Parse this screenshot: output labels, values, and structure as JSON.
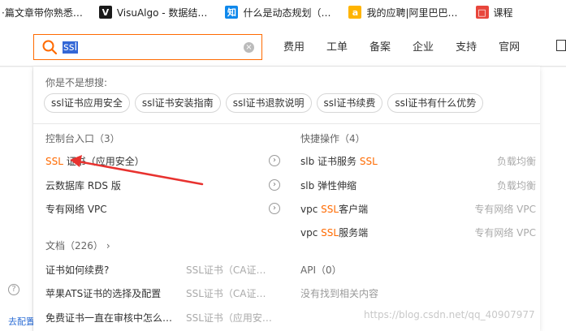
{
  "bookmarks": [
    {
      "icon": "doc-icon",
      "label": "·篇文章带你熟悉…"
    },
    {
      "icon": "visualgo-icon",
      "label": "VisuAlgo - 数据结…"
    },
    {
      "icon": "zhihu-icon",
      "label": "什么是动态规划（…"
    },
    {
      "icon": "ali-icon",
      "label": "我的应聘|阿里巴巴…"
    },
    {
      "icon": "course-icon",
      "label": "课程"
    }
  ],
  "search": {
    "value": "ssl"
  },
  "nav": [
    "费用",
    "工单",
    "备案",
    "企业",
    "支持",
    "官网"
  ],
  "suggest": {
    "title": "你是不是想搜:",
    "chips": [
      "ssl证书应用安全",
      "ssl证书安装指南",
      "ssl证书退款说明",
      "ssl证书续费",
      "ssl证书有什么优势"
    ]
  },
  "console": {
    "title": "控制台入口（3）",
    "items": [
      {
        "pre": "",
        "hl": "SSL",
        "post": " 证书",
        "suffix": "（应用安全）"
      },
      {
        "pre": "云数据库 RDS 版",
        "hl": "",
        "post": "",
        "suffix": ""
      },
      {
        "pre": "专有网络 VPC",
        "hl": "",
        "post": "",
        "suffix": ""
      }
    ]
  },
  "quick": {
    "title": "快捷操作（4）",
    "items": [
      {
        "pre": "slb 证书服务 ",
        "hl": "SSL",
        "post": "",
        "tag": "负载均衡"
      },
      {
        "pre": "slb 弹性伸缩",
        "hl": "",
        "post": "",
        "tag": "负载均衡"
      },
      {
        "pre": "vpc ",
        "hl": "SSL",
        "post": "客户端",
        "tag": "专有网络 VPC"
      },
      {
        "pre": "vpc ",
        "hl": "SSL",
        "post": "服务端",
        "tag": "专有网络 VPC"
      }
    ]
  },
  "docs": {
    "title": "文档（226）",
    "chevron": "›",
    "items": [
      {
        "text": "证书如何续费?",
        "tag": "SSL证书（CA证…"
      },
      {
        "text": "苹果ATS证书的选择及配置",
        "tag": "SSL证书（CA证…"
      },
      {
        "text": "免费证书一直在审核中怎么…",
        "tag": "SSL证书（应用安…"
      }
    ]
  },
  "api": {
    "title": "API（0）",
    "empty": "没有找到相关内容"
  },
  "background": {
    "help": "?",
    "link": "去配置"
  },
  "watermark": "https://blog.csdn.net/qq_40907977",
  "colors": {
    "accent": "#ff6a00",
    "selection": "#3367d6",
    "annotation_arrow": "#e8322f"
  }
}
